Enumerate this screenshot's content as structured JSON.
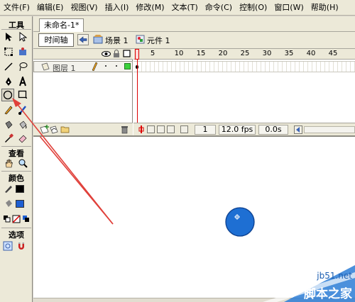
{
  "menu": [
    "文件(F)",
    "编辑(E)",
    "视图(V)",
    "插入(I)",
    "修改(M)",
    "文本(T)",
    "命令(C)",
    "控制(O)",
    "窗口(W)",
    "帮助(H)"
  ],
  "tools": {
    "title": "工具",
    "view_title": "查看",
    "color_title": "颜色",
    "options_title": "选项",
    "stroke_color": "#000000",
    "fill_color": "#1e5fd2"
  },
  "document": {
    "tab_label": "未命名-1*"
  },
  "editbar": {
    "timeline_label": "时间轴",
    "scene_label": "场景 1",
    "symbol_label": "元件 1"
  },
  "timeline": {
    "layer_name": "图层 1",
    "ruler_labels": [
      "5",
      "10",
      "15",
      "20",
      "25",
      "30",
      "35",
      "40",
      "45"
    ],
    "current_frame": "1",
    "frame_rate": "12.0 fps",
    "elapsed_time": "0.0s"
  },
  "stage": {
    "circle_fill": "#1e6fd3",
    "circle_stroke": "#0b3f8f"
  },
  "watermark": {
    "url": "jb51.net",
    "name": "脚本之家"
  }
}
